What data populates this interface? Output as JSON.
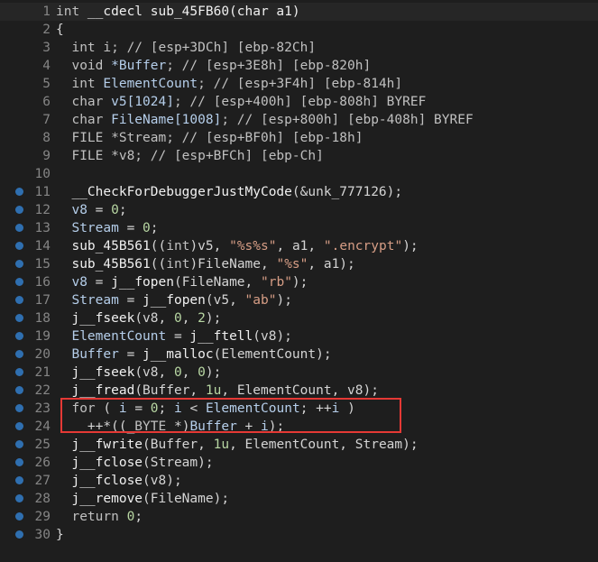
{
  "lines": [
    {
      "num": "1",
      "has_bp": false,
      "tokens": [
        {
          "t": "kw",
          "v": "int "
        },
        {
          "t": "fn",
          "v": "__cdecl sub_45FB60(char a1)"
        }
      ]
    },
    {
      "num": "2",
      "has_bp": false,
      "tokens": [
        {
          "t": "op",
          "v": "{"
        }
      ]
    },
    {
      "num": "3",
      "has_bp": false,
      "tokens": [
        {
          "t": "kw",
          "v": "  int i; // [esp+3DCh] [ebp-82Ch]"
        }
      ]
    },
    {
      "num": "4",
      "has_bp": false,
      "tokens": [
        {
          "t": "kw",
          "v": "  void "
        },
        {
          "t": "var",
          "v": "*Buffer"
        },
        {
          "t": "kw",
          "v": "; // [esp+3E8h] [ebp-820h]"
        }
      ]
    },
    {
      "num": "5",
      "has_bp": false,
      "tokens": [
        {
          "t": "kw",
          "v": "  int "
        },
        {
          "t": "var",
          "v": "ElementCount"
        },
        {
          "t": "kw",
          "v": "; // [esp+3F4h] [ebp-814h]"
        }
      ]
    },
    {
      "num": "6",
      "has_bp": false,
      "tokens": [
        {
          "t": "kw",
          "v": "  char "
        },
        {
          "t": "var",
          "v": "v5[1024]"
        },
        {
          "t": "kw",
          "v": "; // [esp+400h] [ebp-808h] BYREF"
        }
      ]
    },
    {
      "num": "7",
      "has_bp": false,
      "tokens": [
        {
          "t": "kw",
          "v": "  char "
        },
        {
          "t": "var",
          "v": "FileName[1008]"
        },
        {
          "t": "kw",
          "v": "; // [esp+800h] [ebp-408h] BYREF"
        }
      ]
    },
    {
      "num": "8",
      "has_bp": false,
      "tokens": [
        {
          "t": "kw",
          "v": "  FILE *Stream; // [esp+BF0h] [ebp-18h]"
        }
      ]
    },
    {
      "num": "9",
      "has_bp": false,
      "tokens": [
        {
          "t": "kw",
          "v": "  FILE *v8; // [esp+BFCh] [ebp-Ch]"
        }
      ]
    },
    {
      "num": "10",
      "has_bp": false,
      "tokens": []
    },
    {
      "num": "11",
      "has_bp": true,
      "tokens": [
        {
          "t": "fn",
          "v": "  __CheckForDebuggerJustMyCode"
        },
        {
          "t": "op",
          "v": "(&unk_777126);"
        }
      ]
    },
    {
      "num": "12",
      "has_bp": true,
      "tokens": [
        {
          "t": "var",
          "v": "  v8"
        },
        {
          "t": "op",
          "v": " = "
        },
        {
          "t": "num",
          "v": "0"
        },
        {
          "t": "op",
          "v": ";"
        }
      ]
    },
    {
      "num": "13",
      "has_bp": true,
      "tokens": [
        {
          "t": "var",
          "v": "  Stream"
        },
        {
          "t": "op",
          "v": " = "
        },
        {
          "t": "num",
          "v": "0"
        },
        {
          "t": "op",
          "v": ";"
        }
      ]
    },
    {
      "num": "14",
      "has_bp": true,
      "tokens": [
        {
          "t": "fn",
          "v": "  sub_45B561"
        },
        {
          "t": "op",
          "v": "(("
        },
        {
          "t": "kw",
          "v": "int"
        },
        {
          "t": "op",
          "v": ")v5, "
        },
        {
          "t": "str",
          "v": "\"%s%s\""
        },
        {
          "t": "op",
          "v": ", a1, "
        },
        {
          "t": "str",
          "v": "\".encrypt\""
        },
        {
          "t": "op",
          "v": ");"
        }
      ]
    },
    {
      "num": "15",
      "has_bp": true,
      "tokens": [
        {
          "t": "fn",
          "v": "  sub_45B561"
        },
        {
          "t": "op",
          "v": "(("
        },
        {
          "t": "kw",
          "v": "int"
        },
        {
          "t": "op",
          "v": ")FileName, "
        },
        {
          "t": "str",
          "v": "\"%s\""
        },
        {
          "t": "op",
          "v": ", a1);"
        }
      ]
    },
    {
      "num": "16",
      "has_bp": true,
      "tokens": [
        {
          "t": "var",
          "v": "  v8"
        },
        {
          "t": "op",
          "v": " = "
        },
        {
          "t": "fn",
          "v": "j__fopen"
        },
        {
          "t": "op",
          "v": "(FileName, "
        },
        {
          "t": "str",
          "v": "\"rb\""
        },
        {
          "t": "op",
          "v": ");"
        }
      ]
    },
    {
      "num": "17",
      "has_bp": true,
      "tokens": [
        {
          "t": "var",
          "v": "  Stream"
        },
        {
          "t": "op",
          "v": " = "
        },
        {
          "t": "fn",
          "v": "j__fopen"
        },
        {
          "t": "op",
          "v": "(v5, "
        },
        {
          "t": "str",
          "v": "\"ab\""
        },
        {
          "t": "op",
          "v": ");"
        }
      ]
    },
    {
      "num": "18",
      "has_bp": true,
      "tokens": [
        {
          "t": "fn",
          "v": "  j__fseek"
        },
        {
          "t": "op",
          "v": "(v8, "
        },
        {
          "t": "num",
          "v": "0"
        },
        {
          "t": "op",
          "v": ", "
        },
        {
          "t": "num",
          "v": "2"
        },
        {
          "t": "op",
          "v": ");"
        }
      ]
    },
    {
      "num": "19",
      "has_bp": true,
      "tokens": [
        {
          "t": "var",
          "v": "  ElementCount"
        },
        {
          "t": "op",
          "v": " = "
        },
        {
          "t": "fn",
          "v": "j__ftell"
        },
        {
          "t": "op",
          "v": "(v8);"
        }
      ]
    },
    {
      "num": "20",
      "has_bp": true,
      "tokens": [
        {
          "t": "var",
          "v": "  Buffer"
        },
        {
          "t": "op",
          "v": " = "
        },
        {
          "t": "fn",
          "v": "j__malloc"
        },
        {
          "t": "op",
          "v": "(ElementCount);"
        }
      ]
    },
    {
      "num": "21",
      "has_bp": true,
      "tokens": [
        {
          "t": "fn",
          "v": "  j__fseek"
        },
        {
          "t": "op",
          "v": "(v8, "
        },
        {
          "t": "num",
          "v": "0"
        },
        {
          "t": "op",
          "v": ", "
        },
        {
          "t": "num",
          "v": "0"
        },
        {
          "t": "op",
          "v": ");"
        }
      ]
    },
    {
      "num": "22",
      "has_bp": true,
      "tokens": [
        {
          "t": "fn",
          "v": "  j__fread"
        },
        {
          "t": "op",
          "v": "(Buffer, "
        },
        {
          "t": "num",
          "v": "1u"
        },
        {
          "t": "op",
          "v": ", ElementCount, v8);"
        }
      ]
    },
    {
      "num": "23",
      "has_bp": true,
      "tokens": [
        {
          "t": "kw",
          "v": "  for"
        },
        {
          "t": "op",
          "v": " ( "
        },
        {
          "t": "var",
          "v": "i"
        },
        {
          "t": "op",
          "v": " = "
        },
        {
          "t": "num",
          "v": "0"
        },
        {
          "t": "op",
          "v": "; "
        },
        {
          "t": "var",
          "v": "i"
        },
        {
          "t": "op",
          "v": " < "
        },
        {
          "t": "var",
          "v": "ElementCount"
        },
        {
          "t": "op",
          "v": "; ++"
        },
        {
          "t": "var",
          "v": "i"
        },
        {
          "t": "op",
          "v": " )"
        }
      ]
    },
    {
      "num": "24",
      "has_bp": true,
      "tokens": [
        {
          "t": "op",
          "v": "    ++*(("
        },
        {
          "t": "kw",
          "v": "_BYTE"
        },
        {
          "t": "op",
          "v": " *)"
        },
        {
          "t": "var",
          "v": "Buffer"
        },
        {
          "t": "op",
          "v": " + "
        },
        {
          "t": "var",
          "v": "i"
        },
        {
          "t": "op",
          "v": ");"
        }
      ]
    },
    {
      "num": "25",
      "has_bp": true,
      "tokens": [
        {
          "t": "fn",
          "v": "  j__fwrite"
        },
        {
          "t": "op",
          "v": "(Buffer, "
        },
        {
          "t": "num",
          "v": "1u"
        },
        {
          "t": "op",
          "v": ", ElementCount, Stream);"
        }
      ]
    },
    {
      "num": "26",
      "has_bp": true,
      "tokens": [
        {
          "t": "fn",
          "v": "  j__fclose"
        },
        {
          "t": "op",
          "v": "(Stream);"
        }
      ]
    },
    {
      "num": "27",
      "has_bp": true,
      "tokens": [
        {
          "t": "fn",
          "v": "  j__fclose"
        },
        {
          "t": "op",
          "v": "(v8);"
        }
      ]
    },
    {
      "num": "28",
      "has_bp": true,
      "tokens": [
        {
          "t": "fn",
          "v": "  j__remove"
        },
        {
          "t": "op",
          "v": "(FileName);"
        }
      ]
    },
    {
      "num": "29",
      "has_bp": true,
      "tokens": [
        {
          "t": "kw",
          "v": "  return "
        },
        {
          "t": "num",
          "v": "0"
        },
        {
          "t": "op",
          "v": ";"
        }
      ]
    },
    {
      "num": "30",
      "has_bp": true,
      "tokens": [
        {
          "t": "op",
          "v": "}"
        }
      ]
    }
  ],
  "current_line": "1",
  "highlight_lines": [
    "23",
    "24"
  ],
  "colors": {
    "background": "#1e1e1e",
    "highlight_border": "#e53935",
    "breakpoint": "#2f6fb0"
  }
}
